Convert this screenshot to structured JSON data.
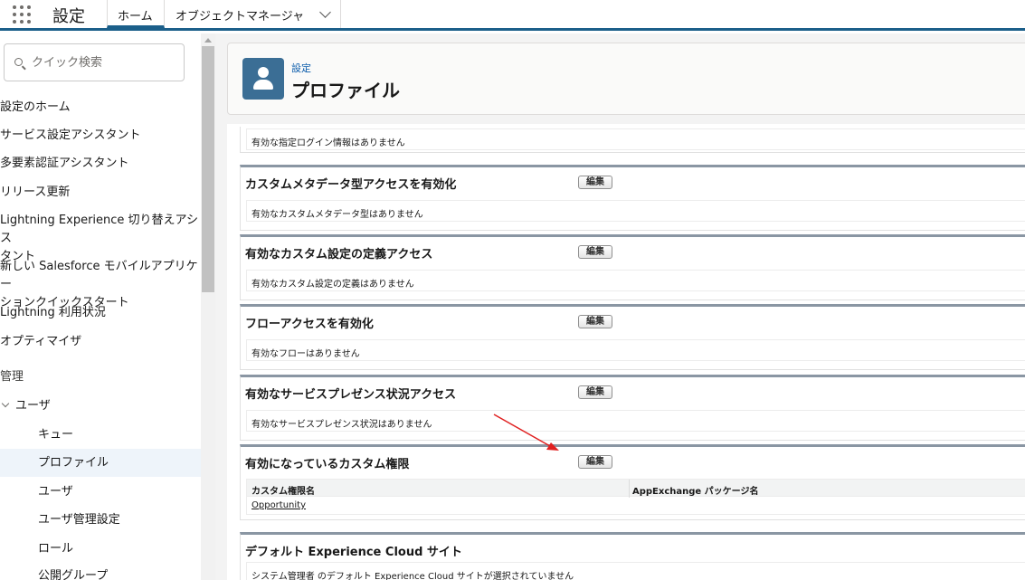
{
  "header": {
    "app_name": "設定",
    "tabs": [
      {
        "label": "ホーム"
      },
      {
        "label": "オブジェクトマネージャ"
      }
    ]
  },
  "sidebar": {
    "search_placeholder": "クイック検索",
    "items": [
      {
        "label": "設定のホーム"
      },
      {
        "label": "サービス設定アシスタント"
      },
      {
        "label": "多要素認証アシスタント"
      },
      {
        "label": "リリース更新"
      },
      {
        "label": "Lightning Experience 切り替えアシス"
      },
      {
        "label": "タント"
      },
      {
        "label": "新しい Salesforce モバイルアプリケー"
      },
      {
        "label": "ションクイックスタート"
      },
      {
        "label": "Lightning 利用状況"
      },
      {
        "label": "オプティマイザ"
      }
    ],
    "section_label": "管理",
    "group_label": "ユーザ",
    "sub_items": [
      {
        "label": "キュー"
      },
      {
        "label": "プロファイル"
      },
      {
        "label": "ユーザ"
      },
      {
        "label": "ユーザ管理設定"
      },
      {
        "label": "ロール"
      },
      {
        "label": "公開グループ"
      }
    ]
  },
  "page": {
    "breadcrumb": "設定",
    "title": "プロファイル"
  },
  "sections": {
    "top_body": "有効な指定ログイン情報はありません",
    "edit_label": "編集",
    "custom_metadata": {
      "title": "カスタムメタデータ型アクセスを有効化",
      "body": "有効なカスタムメタデータ型はありません"
    },
    "custom_settings": {
      "title": "有効なカスタム設定の定義アクセス",
      "body": "有効なカスタム設定の定義はありません"
    },
    "flow": {
      "title": "フローアクセスを有効化",
      "body": "有効なフローはありません"
    },
    "service_presence": {
      "title": "有効なサービスプレゼンス状況アクセス",
      "body": "有効なサービスプレゼンス状況はありません"
    },
    "custom_permissions": {
      "title": "有効になっているカスタム権限",
      "columns": [
        "カスタム権限名",
        "AppExchange パッケージ名"
      ],
      "rows": [
        {
          "name": "Opportunity"
        }
      ]
    },
    "experience_cloud": {
      "title": "デフォルト Experience Cloud サイト",
      "body": "システム管理者 のデフォルト Experience Cloud サイトが選択されていません"
    }
  },
  "colors": {
    "brand": "#1b5f8a",
    "icon_bg": "#3b6e95",
    "link": "#0b5cab",
    "annotation_arrow": "#e02020"
  }
}
